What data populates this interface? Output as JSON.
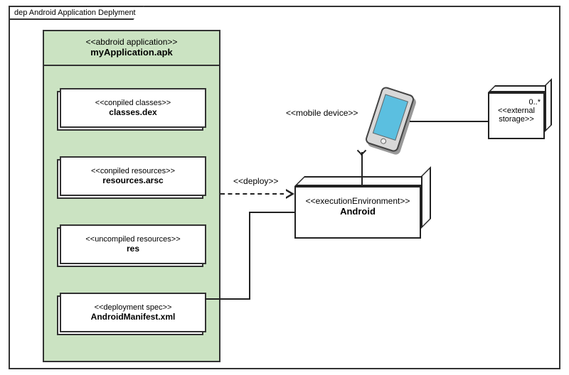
{
  "frame": {
    "title": "dep Android Application Deplyment"
  },
  "apk": {
    "stereotype": "<<abdroid application>>",
    "name": "myApplication.apk",
    "artifacts": [
      {
        "stereotype": "<<conpiled classes>>",
        "name": "classes.dex"
      },
      {
        "stereotype": "<<conpiled resources>>",
        "name": "resources.arsc"
      },
      {
        "stereotype": "<<uncompiled resources>>",
        "name": "res"
      },
      {
        "stereotype": "<<deployment spec>>",
        "name": "AndroidManifest.xml"
      }
    ]
  },
  "android": {
    "stereotype": "<<executionEnvironment>>",
    "name": "Android"
  },
  "storage": {
    "multiplicity": "0..*",
    "stereotype": "<<external storage>>"
  },
  "labels": {
    "deploy": "<<deploy>>",
    "mobile": "<<mobile device>>"
  }
}
